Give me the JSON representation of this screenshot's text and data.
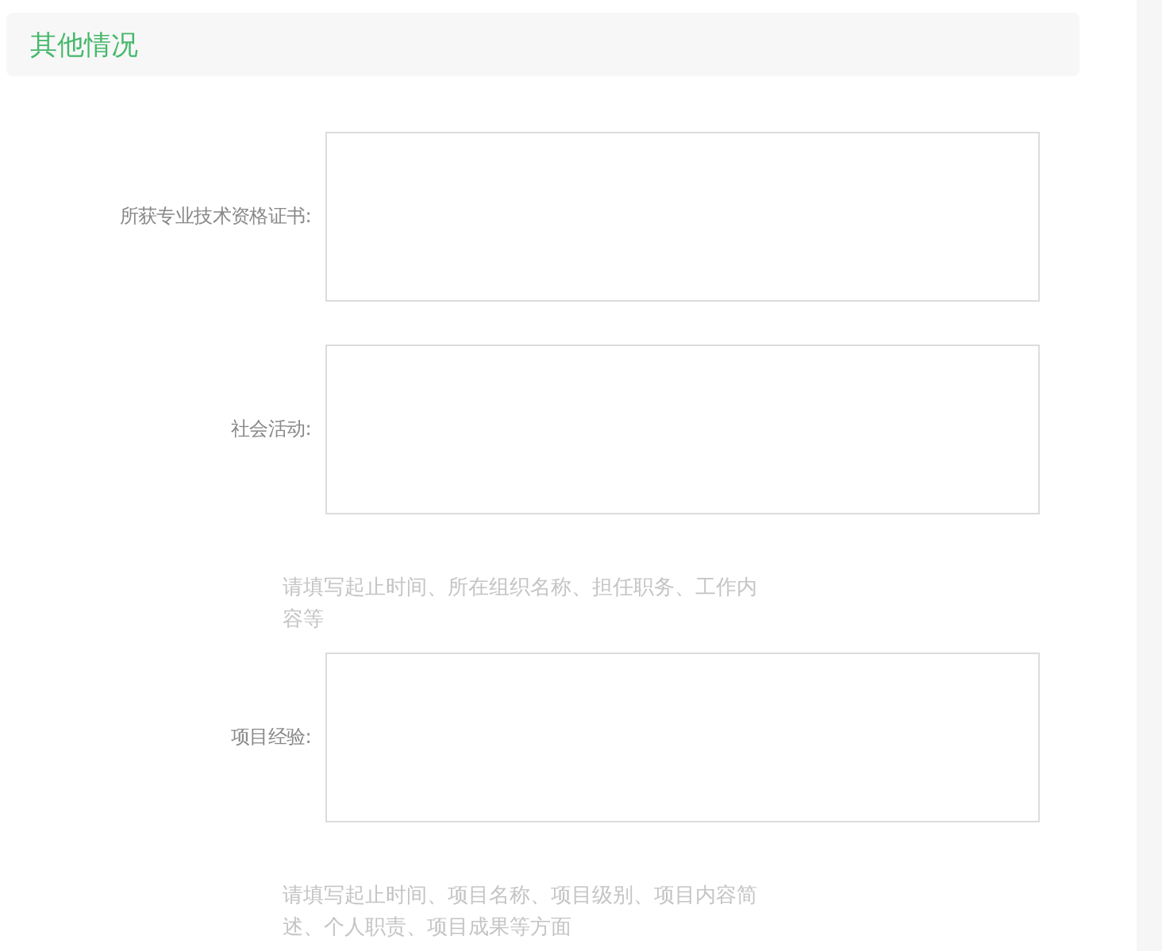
{
  "section": {
    "title": "其他情况"
  },
  "fields": [
    {
      "label": "所获专业技术资格证书:"
    },
    {
      "label": "社会活动:",
      "hint": "请填写起止时间、所在组织名称、担任职务、工作内容等"
    },
    {
      "label": "项目经验:",
      "hint": "请填写起止时间、项目名称、项目级别、项目内容简述、个人职责、项目成果等方面"
    }
  ]
}
